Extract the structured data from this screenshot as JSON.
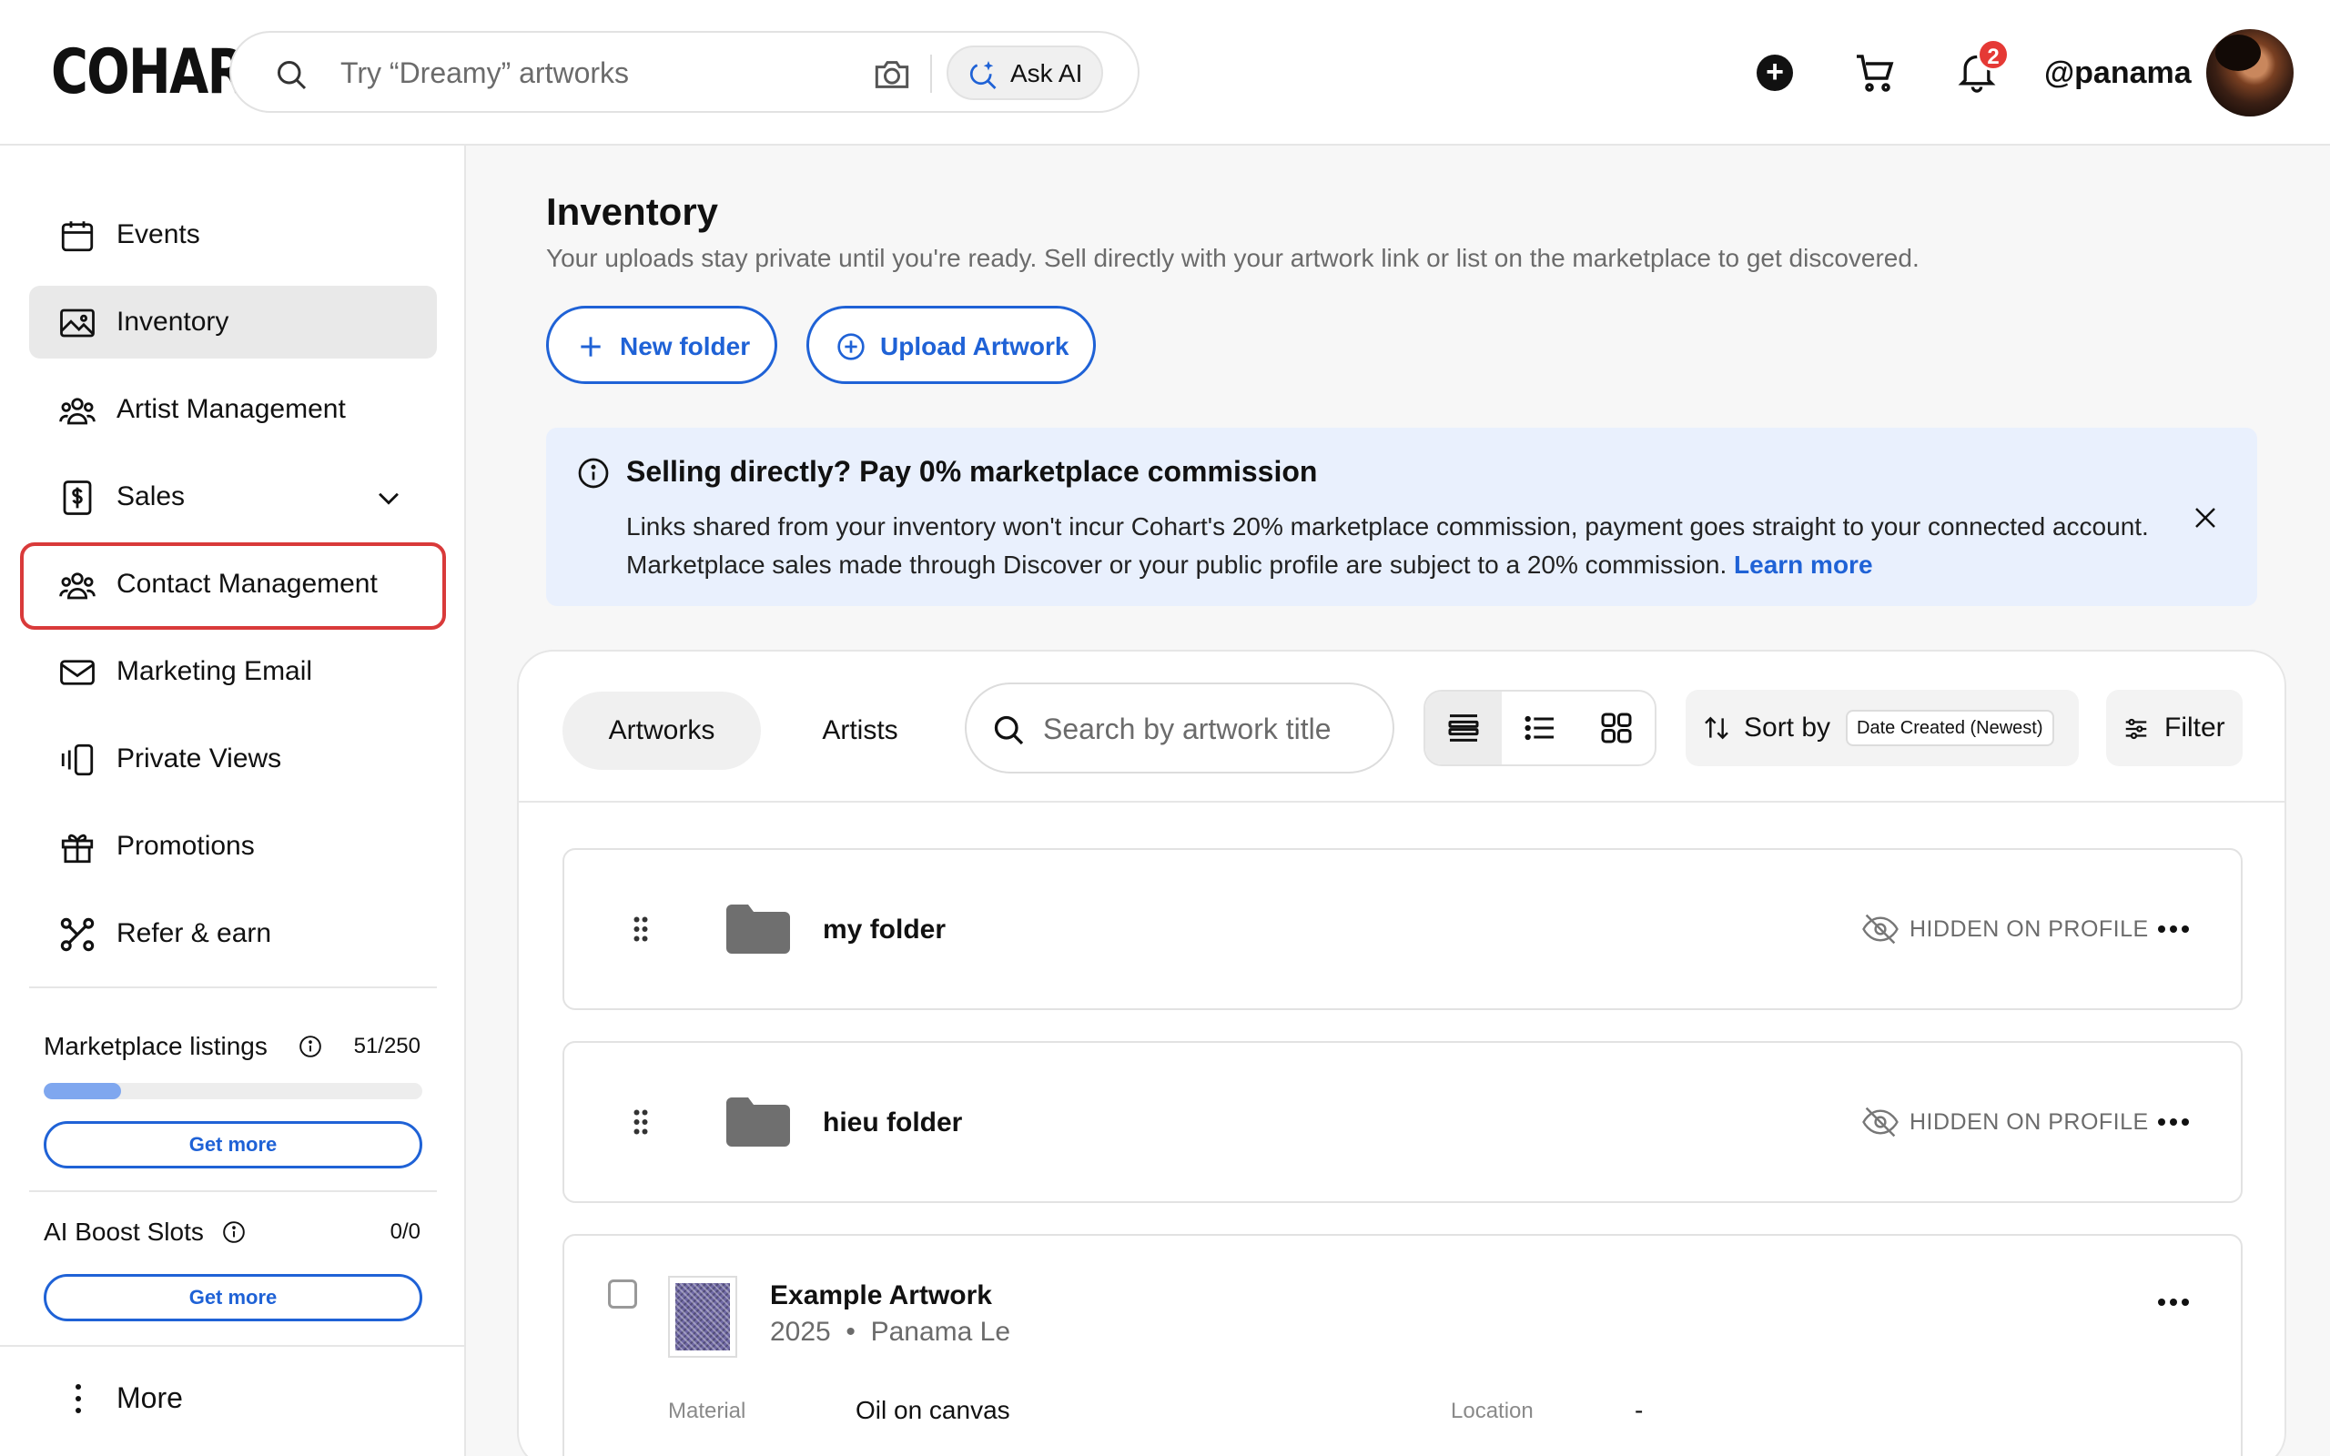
{
  "header": {
    "logo": "COHART",
    "search_placeholder": "Try “Dreamy” artworks",
    "ask_ai_label": "Ask AI",
    "notification_count": "2",
    "username": "@panama"
  },
  "sidebar": {
    "items": [
      {
        "label": "Events",
        "icon": "calendar-icon"
      },
      {
        "label": "Inventory",
        "icon": "image-icon",
        "active": true
      },
      {
        "label": "Artist Management",
        "icon": "users-icon"
      },
      {
        "label": "Sales",
        "icon": "dollar-doc-icon",
        "expandable": true
      },
      {
        "label": "Contact Management",
        "icon": "users-icon",
        "highlighted": true
      },
      {
        "label": "Marketing Email",
        "icon": "mail-icon"
      },
      {
        "label": "Private Views",
        "icon": "private-views-icon"
      },
      {
        "label": "Promotions",
        "icon": "gift-icon"
      },
      {
        "label": "Refer & earn",
        "icon": "share-icon"
      }
    ],
    "marketplace": {
      "title": "Marketplace listings",
      "count": "51/250",
      "progress_fraction": 0.204,
      "button": "Get more"
    },
    "ai_boost": {
      "title": "AI Boost Slots",
      "count": "0/0",
      "button": "Get more"
    },
    "more_label": "More"
  },
  "main": {
    "title": "Inventory",
    "subtitle": "Your uploads stay private until you're ready. Sell directly with your artwork link or list on the marketplace to get discovered.",
    "new_folder_label": "New folder",
    "upload_label": "Upload Artwork",
    "banner": {
      "title": "Selling directly? Pay 0% marketplace commission",
      "body": "Links shared from your inventory won't incur Cohart's 20% marketplace commission, payment goes straight to your connected account. Marketplace sales made through Discover or your public profile are subject to a 20% commission.",
      "link": "Learn more"
    },
    "tabs": [
      {
        "label": "Artworks",
        "active": true
      },
      {
        "label": "Artists",
        "active": false
      }
    ],
    "search_placeholder": "Search by artwork title",
    "view_modes": [
      "compact-list",
      "list",
      "grid"
    ],
    "active_view": "compact-list",
    "sort_label": "Sort by",
    "sort_value": "Date Created (Newest)",
    "filter_label": "Filter",
    "folders": [
      {
        "name": "my folder",
        "status": "HIDDEN ON PROFILE"
      },
      {
        "name": "hieu folder",
        "status": "HIDDEN ON PROFILE"
      }
    ],
    "artwork": {
      "title": "Example Artwork",
      "year": "2025",
      "separator": "•",
      "artist": "Panama Le",
      "material_label": "Material",
      "material_value": "Oil on canvas",
      "location_label": "Location",
      "location_value": "-"
    }
  },
  "colors": {
    "accent": "#1f62d6",
    "banner_bg": "#e9f0fd",
    "highlight": "#d93a3a",
    "badge": "#e53935"
  }
}
